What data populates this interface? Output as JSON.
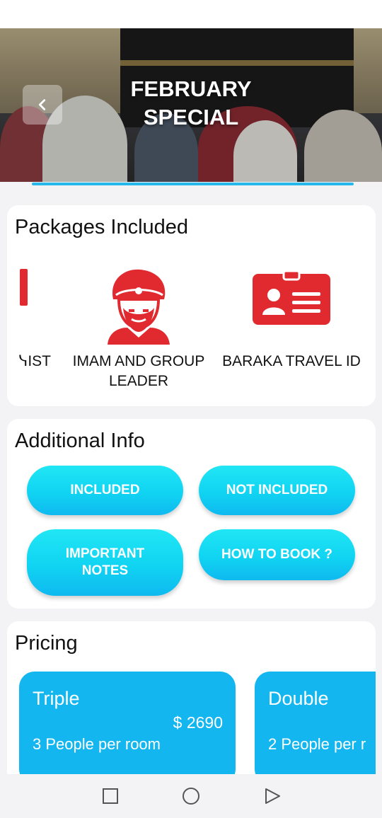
{
  "header": {
    "title_line1": "FEBRUARY",
    "title_line2": "SPECIAL",
    "back_icon": "chevron-left-icon"
  },
  "packages": {
    "title": "Packages Included",
    "items": [
      {
        "label": "ᓭIST",
        "icon": "partial-red-icon"
      },
      {
        "label": "IMAM AND GROUP LEADER",
        "icon": "imam-turban-icon"
      },
      {
        "label": "BARAKA TRAVEL ID",
        "icon": "id-card-icon"
      }
    ]
  },
  "additional": {
    "title": "Additional Info",
    "buttons": {
      "included": "INCLUDED",
      "not_included": "NOT INCLUDED",
      "important_notes": "IMPORTANT NOTES",
      "how_to_book": "HOW TO BOOK ?"
    }
  },
  "pricing": {
    "title": "Pricing",
    "cards": [
      {
        "type": "Triple",
        "amount": "$ 2690",
        "desc": "3 People per room"
      },
      {
        "type": "Double",
        "amount": "",
        "desc": "2 People per r"
      }
    ]
  },
  "navbar": {
    "recent_icon": "square-icon",
    "home_icon": "circle-icon",
    "back_icon": "triangle-back-icon"
  },
  "colors": {
    "accent": "#14b6ef",
    "button_cyan": "#10d4f2",
    "icon_red": "#e12a2f"
  }
}
